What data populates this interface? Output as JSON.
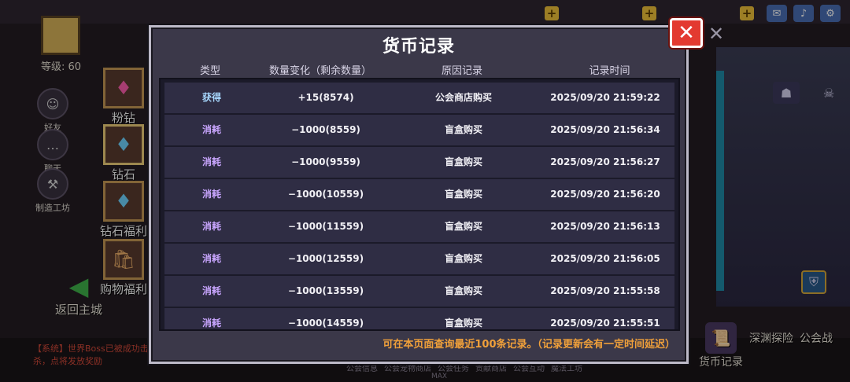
{
  "player": {
    "level_label": "等级: 60"
  },
  "sidebar": {
    "items": [
      {
        "label": "好友",
        "icon": "friends-icon",
        "glyph": "☺"
      },
      {
        "label": "聊天",
        "icon": "chat-icon",
        "glyph": "…"
      },
      {
        "label": "制造工坊",
        "icon": "workshop-icon",
        "glyph": "⚒"
      }
    ]
  },
  "tabs": [
    {
      "label": "粉钻",
      "icon": "pink-diamond-icon",
      "glyph": "♦"
    },
    {
      "label": "钻石",
      "icon": "diamond-icon",
      "glyph": "♦"
    },
    {
      "label": "钻石福利",
      "icon": "diamond-welfare-icon",
      "glyph": "♦"
    },
    {
      "label": "购物福利",
      "icon": "shopping-welfare-icon",
      "glyph": "🛍"
    }
  ],
  "back": {
    "label": "返回主城"
  },
  "broadcast": {
    "text": "【系统】世界Boss已被成功击杀，点将发放奖励"
  },
  "right_buttons": [
    {
      "label": "货币记录",
      "icon": "currency-record-icon",
      "glyph": "📜"
    },
    {
      "label": "深渊探险",
      "icon": "abyss-icon",
      "glyph": "◉"
    },
    {
      "label": "公会战",
      "icon": "guild-war-icon",
      "glyph": "⚔"
    }
  ],
  "bottom_nav": [
    "公会信息",
    "公会宠物商店",
    "公会任务",
    "贡献商店",
    "公会互动",
    "魔法工坊"
  ],
  "bottom_max": "MAX",
  "dialog": {
    "title": "货币记录",
    "columns": {
      "type": "类型",
      "amount": "数量变化（剩余数量）",
      "reason": "原因记录",
      "time": "记录时间"
    },
    "rows": [
      {
        "type": "获得",
        "amount": "+15(8574)",
        "reason": "公会商店购买",
        "time": "2025/09/20 21:59:22"
      },
      {
        "type": "消耗",
        "amount": "−1000(8559)",
        "reason": "盲盒购买",
        "time": "2025/09/20 21:56:34"
      },
      {
        "type": "消耗",
        "amount": "−1000(9559)",
        "reason": "盲盒购买",
        "time": "2025/09/20 21:56:27"
      },
      {
        "type": "消耗",
        "amount": "−1000(10559)",
        "reason": "盲盒购买",
        "time": "2025/09/20 21:56:20"
      },
      {
        "type": "消耗",
        "amount": "−1000(11559)",
        "reason": "盲盒购买",
        "time": "2025/09/20 21:56:13"
      },
      {
        "type": "消耗",
        "amount": "−1000(12559)",
        "reason": "盲盒购买",
        "time": "2025/09/20 21:56:05"
      },
      {
        "type": "消耗",
        "amount": "−1000(13559)",
        "reason": "盲盒购买",
        "time": "2025/09/20 21:55:58"
      },
      {
        "type": "消耗",
        "amount": "−1000(14559)",
        "reason": "盲盒购买",
        "time": "2025/09/20 21:55:51"
      }
    ],
    "footer_note": "可在本页面查询最近100条记录。（记录更新会有一定时间延迟）",
    "close_glyph": "✕"
  },
  "top_icons": [
    {
      "icon": "mail-icon",
      "glyph": "✉"
    },
    {
      "icon": "sound-icon",
      "glyph": "♪"
    },
    {
      "icon": "settings-gear-icon",
      "glyph": "⚙"
    }
  ],
  "colors": {
    "gain": "#a8d8ff",
    "spend": "#c9a6ff",
    "accent_orange": "#f0a03a",
    "close_red": "#e33a30"
  }
}
